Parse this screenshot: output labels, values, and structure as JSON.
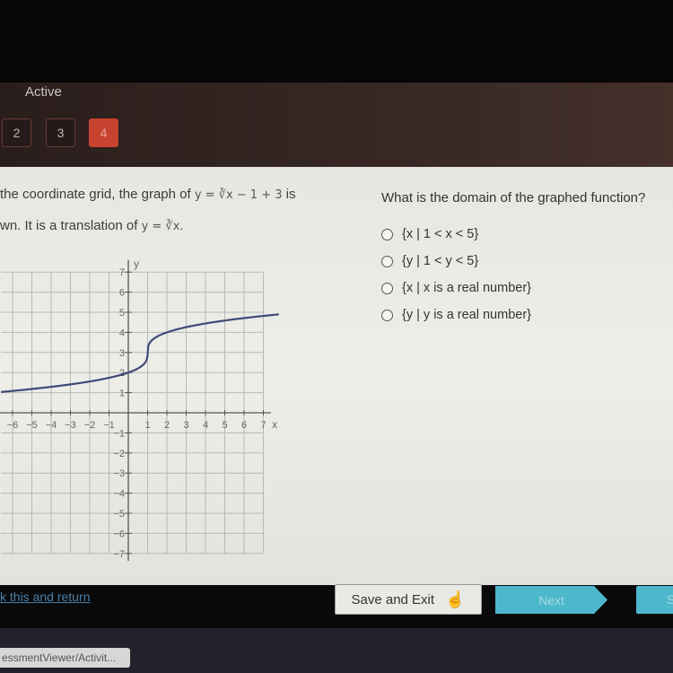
{
  "header": {
    "status": "Active",
    "question_tabs": [
      "2",
      "3",
      "4"
    ],
    "current_tab": "4",
    "accent": "#c8432f"
  },
  "prompt": {
    "line1_pre": "the coordinate grid, the graph of ",
    "line1_eq": "y = ∛x − 1 + 3",
    "line1_post": " is",
    "line2_pre": "wn. It is a translation of ",
    "line2_eq": "y = ∛x."
  },
  "question": {
    "text": "What is the domain of the graphed function?",
    "options": [
      "{x | 1 < x < 5}",
      "{y | 1 < y < 5}",
      "{x | x is a real number}",
      "{y | y is a real number}"
    ]
  },
  "chart_data": {
    "type": "line",
    "function": "y = cbrt(x - 1) + 3",
    "xlabel": "x",
    "ylabel": "y",
    "xlim": [
      -6.6,
      7.8
    ],
    "ylim": [
      -7,
      7
    ],
    "x_ticks": [
      "-6",
      "-5",
      "-4",
      "-3",
      "-2",
      "-1",
      "1",
      "2",
      "3",
      "4",
      "5",
      "6",
      "7"
    ],
    "y_ticks": [
      "7",
      "6",
      "5",
      "4",
      "3",
      "2",
      "1",
      "-1",
      "-2",
      "-3",
      "-4",
      "-5",
      "-6",
      "-7"
    ],
    "grid": true,
    "points": [
      [
        -6.6,
        1.03
      ],
      [
        -5,
        1.18
      ],
      [
        -3,
        1.41
      ],
      [
        -1,
        1.74
      ],
      [
        0,
        2
      ],
      [
        0.875,
        2.5
      ],
      [
        1,
        3
      ],
      [
        1.125,
        3.5
      ],
      [
        2,
        4
      ],
      [
        3,
        4.26
      ],
      [
        5,
        4.59
      ],
      [
        7,
        4.82
      ],
      [
        7.8,
        4.89
      ]
    ]
  },
  "footer": {
    "mark_link": "k this and return",
    "save_exit": "Save and Exit",
    "next": "Next",
    "submit": "S",
    "url": "essmentViewer/Activit..."
  }
}
